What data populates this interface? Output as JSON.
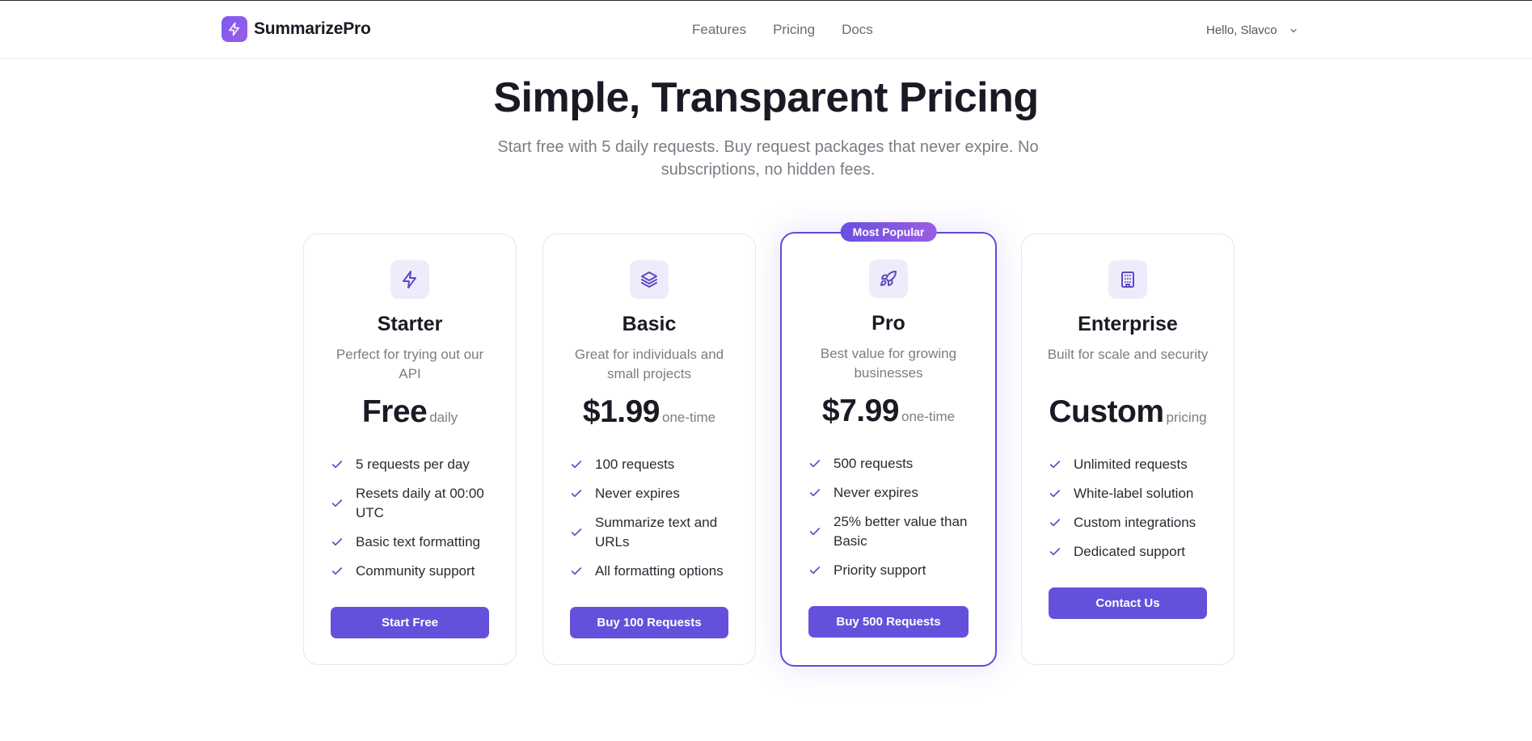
{
  "app": {
    "brand_name": "SummarizePro",
    "accent_color": "#6451db",
    "brand_icon": "lightning-bolt-icon"
  },
  "nav": {
    "items": [
      {
        "label": "Features"
      },
      {
        "label": "Pricing"
      },
      {
        "label": "Docs"
      }
    ]
  },
  "user": {
    "greeting": "Hello, Slavco",
    "menu_icon": "chevron-down-icon"
  },
  "hero": {
    "title": "Simple, Transparent Pricing",
    "subtitle": "Start free with 5 daily requests. Buy request packages that never expire. No subscriptions, no hidden fees."
  },
  "plans": [
    {
      "icon": "lightning-bolt-icon",
      "name": "Starter",
      "description": "Perfect for trying out our API",
      "price": "Free",
      "period": "daily",
      "features": [
        "5 requests per day",
        "Resets daily at 00:00 UTC",
        "Basic text formatting",
        "Community support"
      ],
      "cta": "Start Free"
    },
    {
      "icon": "layers-icon",
      "name": "Basic",
      "description": "Great for individuals and small projects",
      "price": "$1.99",
      "period": "one-time",
      "features": [
        "100 requests",
        "Never expires",
        "Summarize text and URLs",
        "All formatting options"
      ],
      "cta": "Buy 100 Requests"
    },
    {
      "icon": "rocket-icon",
      "badge": "Most Popular",
      "name": "Pro",
      "description": "Best value for growing businesses",
      "price": "$7.99",
      "period": "one-time",
      "features": [
        "500 requests",
        "Never expires",
        "25% better value than Basic",
        "Priority support"
      ],
      "cta": "Buy 500 Requests"
    },
    {
      "icon": "building-icon",
      "name": "Enterprise",
      "description": "Built for scale and security",
      "price": "Custom",
      "period": "pricing",
      "features": [
        "Unlimited requests",
        "White-label solution",
        "Custom integrations",
        "Dedicated support"
      ],
      "cta": "Contact Us"
    }
  ]
}
